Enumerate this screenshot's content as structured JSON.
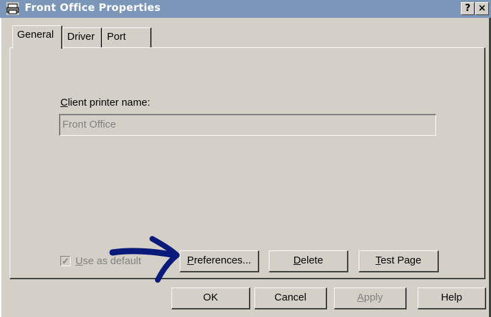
{
  "window": {
    "title": "Front Office Properties",
    "help_button": "?",
    "close_button": "×"
  },
  "tabs": [
    {
      "label": "General",
      "active": true
    },
    {
      "label": "Driver",
      "active": false
    },
    {
      "label": "Port",
      "active": false
    }
  ],
  "general": {
    "client_printer_label_accel": "C",
    "client_printer_label_rest": "lient printer name:",
    "client_printer_value": "Front Office",
    "use_as_default_accel": "U",
    "use_as_default_rest": "se as default",
    "use_as_default_checked": true,
    "preferences_accel": "P",
    "preferences_rest": "references...",
    "delete_accel": "D",
    "delete_rest": "elete",
    "test_page_accel": "T",
    "test_page_rest": "est Page"
  },
  "footer": {
    "ok": "OK",
    "cancel": "Cancel",
    "apply_accel": "A",
    "apply_rest": "pply",
    "help": "Help"
  },
  "colors": {
    "titlebar": "#7b96b8",
    "face": "#d4d0c8",
    "annotation_arrow": "#0a1a7a"
  }
}
